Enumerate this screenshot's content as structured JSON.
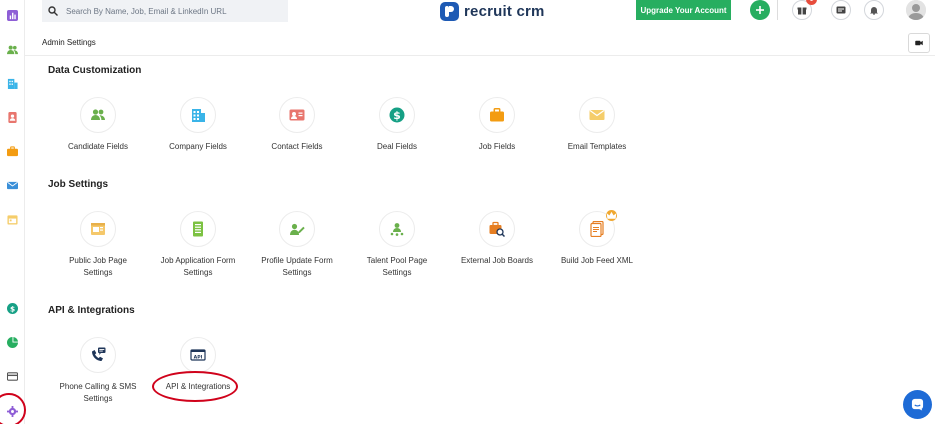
{
  "topbar": {
    "search_placeholder": "Search By Name, Job, Email & LinkedIn URL",
    "logo_text": "recruit crm",
    "upgrade_label": "Upgrade Your Account",
    "notification_count": "1"
  },
  "header": {
    "title": "Admin Settings"
  },
  "sections": {
    "data_customization": {
      "title": "Data Customization",
      "items": [
        {
          "label": "Candidate Fields",
          "icon": "users-icon",
          "color": "#6ab04c"
        },
        {
          "label": "Company Fields",
          "icon": "building-icon",
          "color": "#3ab4e8"
        },
        {
          "label": "Contact Fields",
          "icon": "contact-card-icon",
          "color": "#e8766e"
        },
        {
          "label": "Deal Fields",
          "icon": "dollar-icon",
          "color": "#16a085"
        },
        {
          "label": "Job Fields",
          "icon": "briefcase-icon",
          "color": "#f39c12"
        },
        {
          "label": "Email Templates",
          "icon": "envelope-icon",
          "color": "#f5cd6a"
        }
      ]
    },
    "job_settings": {
      "title": "Job Settings",
      "items": [
        {
          "label_1": "Public Job Page",
          "label_2": "Settings",
          "icon": "job-page-icon",
          "color": "#f5c86a"
        },
        {
          "label_1": "Job Application Form",
          "label_2": "Settings",
          "icon": "form-icon",
          "color": "#7cc242"
        },
        {
          "label_1": "Profile Update Form",
          "label_2": "Settings",
          "icon": "profile-edit-icon",
          "color": "#6ab04c"
        },
        {
          "label_1": "Talent Pool Page",
          "label_2": "Settings",
          "icon": "talent-pool-icon",
          "color": "#6ab04c"
        },
        {
          "label_1": "External Job Boards",
          "label_2": "",
          "icon": "job-search-icon",
          "color": "#e67e22"
        },
        {
          "label_1": "Build Job Feed XML",
          "label_2": "",
          "icon": "xml-feed-icon",
          "color": "#e67e22"
        }
      ]
    },
    "api_integrations": {
      "title": "API & Integrations",
      "items": [
        {
          "label_1": "Phone Calling & SMS",
          "label_2": "Settings",
          "icon": "phone-sms-icon",
          "color": "#1f3659"
        },
        {
          "label_1": "API & Integrations",
          "label_2": "",
          "icon": "api-icon",
          "color": "#1f3659"
        }
      ]
    }
  },
  "sidebar": {
    "items": [
      {
        "icon": "reports-icon",
        "color": "#8e5ed6"
      },
      {
        "icon": "candidates-icon",
        "color": "#6ab04c"
      },
      {
        "icon": "companies-icon",
        "color": "#3ab4e8"
      },
      {
        "icon": "contacts-icon",
        "color": "#e8766e"
      },
      {
        "icon": "jobs-icon",
        "color": "#f39c12"
      },
      {
        "icon": "email-icon",
        "color": "#3a8fd8"
      },
      {
        "icon": "calendar-icon",
        "color": "#f5cd6a"
      },
      {
        "icon": "deals-icon",
        "color": "#16a085"
      },
      {
        "icon": "analytics-icon",
        "color": "#27ae60"
      },
      {
        "icon": "billing-icon",
        "color": "#555555"
      },
      {
        "icon": "settings-icon",
        "color": "#8e5ed6"
      }
    ]
  }
}
